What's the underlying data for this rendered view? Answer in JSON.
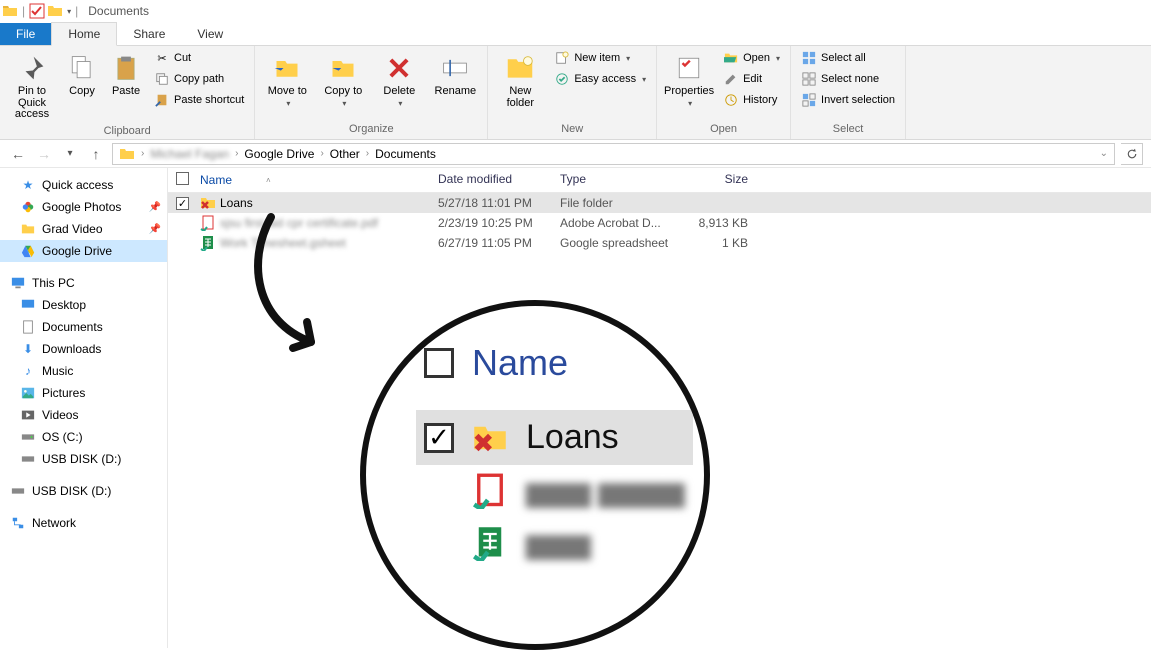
{
  "title": "Documents",
  "tabs": {
    "file": "File",
    "home": "Home",
    "share": "Share",
    "view": "View"
  },
  "ribbon": {
    "clipboard": {
      "pin": "Pin to Quick access",
      "copy": "Copy",
      "paste": "Paste",
      "cut": "Cut",
      "copypath": "Copy path",
      "pasteshortcut": "Paste shortcut",
      "group": "Clipboard"
    },
    "organize": {
      "moveto": "Move to",
      "copyto": "Copy to",
      "delete": "Delete",
      "rename": "Rename",
      "group": "Organize"
    },
    "new": {
      "newfolder": "New folder",
      "newitem": "New item",
      "easyaccess": "Easy access",
      "group": "New"
    },
    "open": {
      "properties": "Properties",
      "open": "Open",
      "edit": "Edit",
      "history": "History",
      "group": "Open"
    },
    "select": {
      "selectall": "Select all",
      "selectnone": "Select none",
      "invert": "Invert selection",
      "group": "Select"
    }
  },
  "breadcrumb": [
    "Michael Fagan",
    "Google Drive",
    "Other",
    "Documents"
  ],
  "nav": {
    "quick_access": "Quick access",
    "google_photos": "Google Photos",
    "grad_video": "Grad Video",
    "google_drive": "Google Drive",
    "this_pc": "This PC",
    "desktop": "Desktop",
    "documents": "Documents",
    "downloads": "Downloads",
    "music": "Music",
    "pictures": "Pictures",
    "videos": "Videos",
    "os_c": "OS (C:)",
    "usb_d_1": "USB DISK (D:)",
    "usb_d_2": "USB DISK (D:)",
    "network": "Network"
  },
  "columns": {
    "name": "Name",
    "date": "Date modified",
    "type": "Type",
    "size": "Size"
  },
  "rows": [
    {
      "checked": true,
      "name": "Loans",
      "date": "5/27/18 11:01 PM",
      "type": "File folder",
      "size": ""
    },
    {
      "checked": false,
      "name": "sjsu first aid cpr certificate.pdf",
      "date": "2/23/19 10:25 PM",
      "type": "Adobe Acrobat D...",
      "size": "8,913 KB"
    },
    {
      "checked": false,
      "name": "Work Timesheet.gsheet",
      "date": "6/27/19 11:05 PM",
      "type": "Google spreadsheet",
      "size": "1 KB"
    }
  ],
  "zoom": {
    "name_label": "Name",
    "item1": "Loans"
  }
}
